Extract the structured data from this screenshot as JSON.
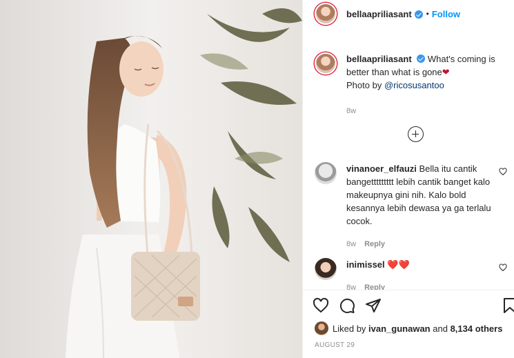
{
  "post": {
    "username": "bellaapriliasant",
    "dot": "•",
    "follow_label": "Follow",
    "caption_user": "bellaapriliasant",
    "caption_text_1": "What's coming is better than what is gone",
    "caption_heart": "❤",
    "caption_text_2": "Photo by ",
    "caption_mention": "@ricosusantoo",
    "caption_time": "8w"
  },
  "comments": [
    {
      "user": "vinanoer_elfauzi",
      "text": "Bella itu cantik bangettttttttt lebih cantik banget kalo makeupnya gini nih. Kalo bold kesannya lebih dewasa ya ga terlalu cocok.",
      "time": "8w",
      "reply": "Reply"
    },
    {
      "user": "inimissel",
      "text": "❤️❤️",
      "time": "8w",
      "reply": "Reply"
    }
  ],
  "actions": {
    "liked_by_prefix": "Liked by ",
    "liked_by_user": "ivan_gunawan",
    "liked_by_mid": " and ",
    "liked_by_count": "8,134 others",
    "date": "AUGUST 29"
  },
  "colors": {
    "accent": "#0095f6",
    "verified": "#3897f0",
    "muted": "#8e8e8e",
    "text": "#262626",
    "heart": "#c0152f"
  }
}
